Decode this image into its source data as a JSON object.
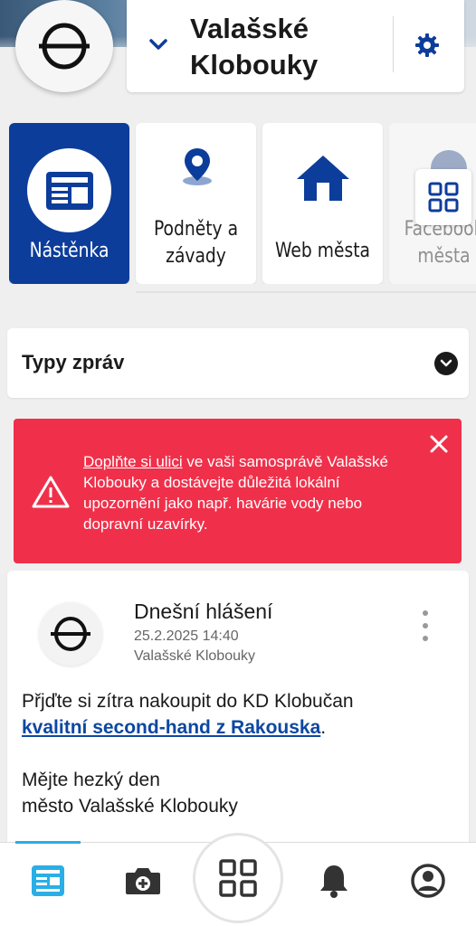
{
  "header": {
    "city_name": "Valašské Klobouky",
    "logo_icon": "city-logo-theta-icon",
    "chevron_icon": "chevron-down-icon",
    "settings_icon": "gear-icon"
  },
  "tiles": [
    {
      "label": "Nástěnka",
      "icon": "newspaper-icon",
      "active": true
    },
    {
      "label": "Podněty a závady",
      "icon": "map-pin-icon",
      "active": false
    },
    {
      "label": "Web města",
      "icon": "house-icon",
      "active": false
    },
    {
      "label": "Facebook města",
      "icon": "facebook-icon",
      "active": false
    }
  ],
  "tiles_grid_icon": "grid-icon",
  "message_types": {
    "label": "Typy zpráv",
    "icon": "chevron-down-circle-icon"
  },
  "alert": {
    "link_text": "Doplňte si ulici",
    "text": " ve vaši samosprávě Valašské Klobouky a dostávejte důležitá lokální upozornění jako např. havárie vody nebo dopravní uzavírky.",
    "icon": "warning-triangle-icon",
    "close_icon": "close-icon",
    "color": "#f0304a"
  },
  "post": {
    "title": "Dnešní hlášení",
    "date": "25.2.2025 14:40",
    "city": "Valašské Klobouky",
    "body_line1": "Přjďte si zítra nakoupit do KD Klobučan",
    "body_link": "kvalitní second-hand z Rakouska",
    "body_link_suffix": ".",
    "signature_line1": "Mějte hezký den",
    "signature_line2": "město Valašské Klobouky",
    "menu_icon": "more-vertical-icon"
  },
  "bottom_nav": [
    {
      "name": "nav-board",
      "icon": "newspaper-icon",
      "active": true
    },
    {
      "name": "nav-report",
      "icon": "camera-plus-icon",
      "active": false
    },
    {
      "name": "nav-apps",
      "icon": "grid-icon",
      "active": false
    },
    {
      "name": "nav-notifications",
      "icon": "bell-icon",
      "active": false
    },
    {
      "name": "nav-profile",
      "icon": "user-circle-icon",
      "active": false
    }
  ],
  "colors": {
    "primary": "#0d3d9b",
    "accent": "#2aaee6",
    "alert": "#f0304a"
  }
}
